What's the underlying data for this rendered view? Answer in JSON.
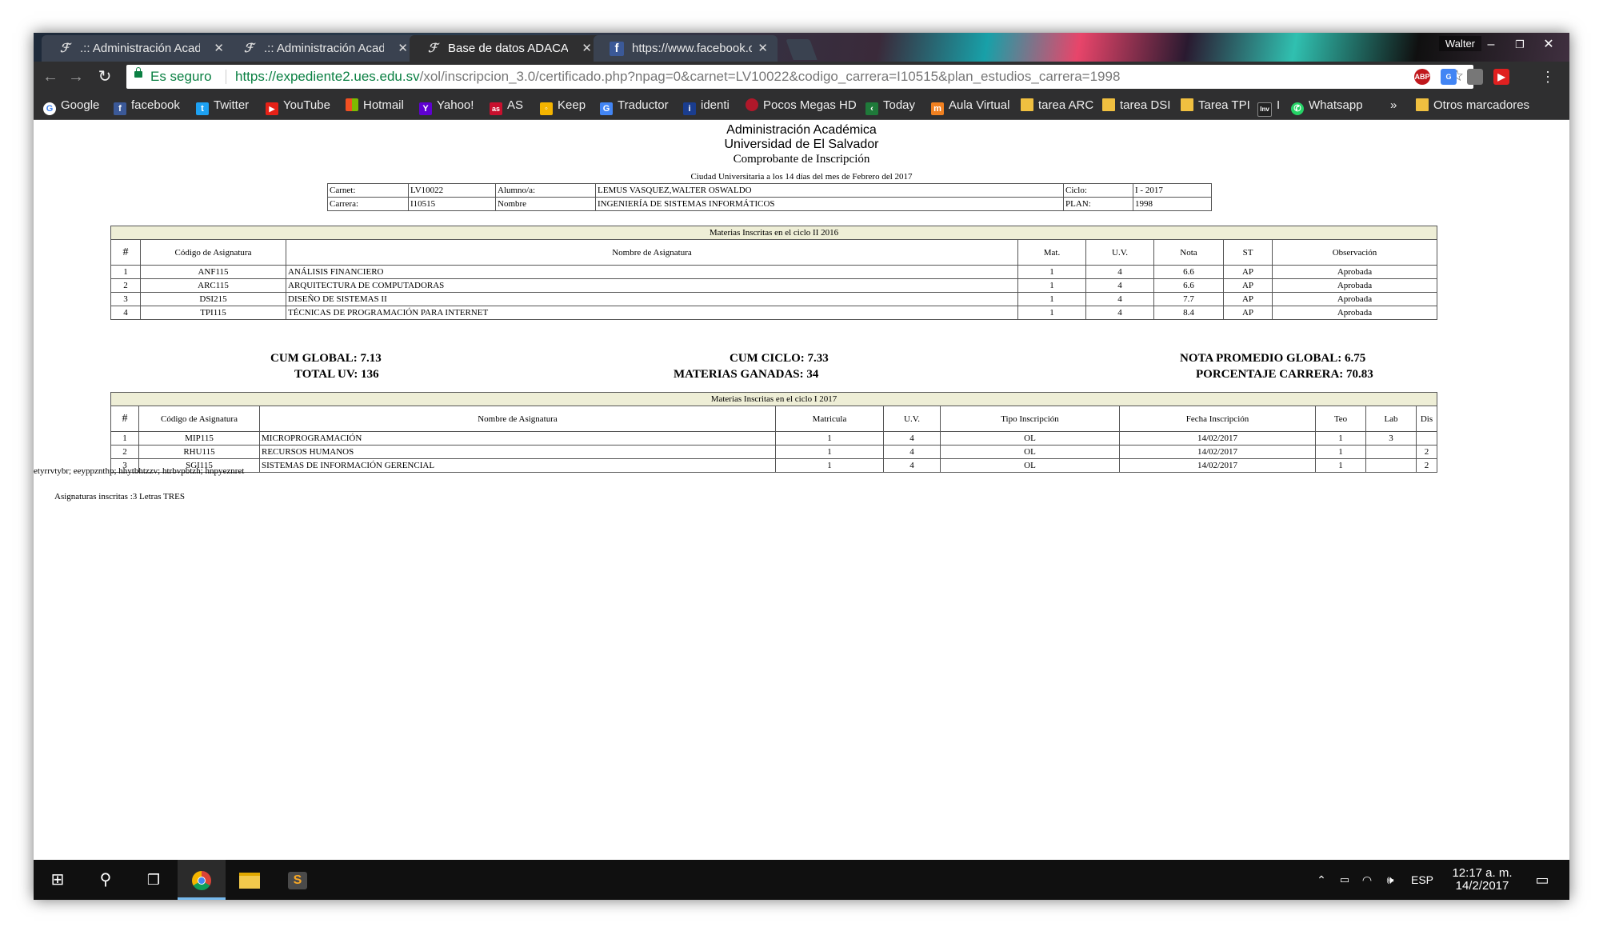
{
  "browser": {
    "tabs": [
      {
        "title": ".:: Administración Académ",
        "icon": "ues-logo-icon"
      },
      {
        "title": ".:: Administración Académ",
        "icon": "ues-logo-icon"
      },
      {
        "title": "Base de datos ADACAD",
        "icon": "ues-logo-icon"
      },
      {
        "title": "https://www.facebook.co",
        "icon": "facebook-icon"
      }
    ],
    "user": "Walter",
    "secure_label": "Es seguro",
    "url_host": "https://expediente2.ues.edu.sv",
    "url_path": "/xol/inscripcion_3.0/certificado.php?npag=0&carnet=LV10022&codigo_carrera=I10515&plan_estudios_carrera=1998",
    "extensions": [
      "ABP",
      "G",
      "",
      ""
    ],
    "bookmarks": [
      "Google",
      "facebook",
      "Twitter",
      "YouTube",
      "Hotmail",
      "Yahoo!",
      "AS",
      "Keep",
      "Traductor",
      "identi",
      "Pocos Megas HD",
      "Today",
      "Aula Virtual",
      "tarea ARC",
      "tarea DSI",
      "Tarea TPI",
      "I",
      "Whatsapp",
      "»",
      "Otros marcadores"
    ]
  },
  "page": {
    "header": {
      "line1": "Administración Académica",
      "line2": "Universidad de El Salvador",
      "line3": "Comprobante de Inscripción",
      "date_line": "Ciudad Universitaria a los 14 días del mes de Febrero del 2017"
    },
    "student": {
      "carnet_label": "Carnet:",
      "carnet": "LV10022",
      "alumno_label": "Alumno/a:",
      "alumno": "LEMUS VASQUEZ,WALTER OSWALDO",
      "ciclo_label": "Ciclo:",
      "ciclo": "I - 2017",
      "carrera_label": "Carrera:",
      "carrera": "I10515",
      "nombre_label": "Nombre",
      "nombre": "INGENIERÍA DE SISTEMAS INFORMÁTICOS",
      "plan_label": "PLAN:",
      "plan": "1998"
    },
    "prev_cycle": {
      "caption": "Materias Inscritas en el ciclo II 2016",
      "headers": [
        "#",
        "Código de Asignatura",
        "Nombre de Asignatura",
        "Mat.",
        "U.V.",
        "Nota",
        "ST",
        "Observación"
      ],
      "rows": [
        [
          "1",
          "ANF115",
          "ANÁLISIS FINANCIERO",
          "1",
          "4",
          "6.6",
          "AP",
          "Aprobada"
        ],
        [
          "2",
          "ARC115",
          "ARQUITECTURA DE COMPUTADORAS",
          "1",
          "4",
          "6.6",
          "AP",
          "Aprobada"
        ],
        [
          "3",
          "DSI215",
          "DISEÑO DE SISTEMAS II",
          "1",
          "4",
          "7.7",
          "AP",
          "Aprobada"
        ],
        [
          "4",
          "TPI115",
          "TÉCNICAS DE PROGRAMACIÓN PARA INTERNET",
          "1",
          "4",
          "8.4",
          "AP",
          "Aprobada"
        ]
      ]
    },
    "stats": {
      "cum_global": "CUM GLOBAL: 7.13",
      "total_uv": "TOTAL UV: 136",
      "cum_ciclo": "CUM CICLO: 7.33",
      "materias_ganadas": "MATERIAS GANADAS: 34",
      "nota_promedio": "NOTA PROMEDIO GLOBAL: 6.75",
      "porcentaje": "PORCENTAJE CARRERA: 70.83"
    },
    "current_cycle": {
      "caption": "Materias Inscritas en el ciclo I 2017",
      "headers": [
        "#",
        "Código de Asignatura",
        "Nombre de Asignatura",
        "Matricula",
        "U.V.",
        "Tipo Inscripción",
        "Fecha Inscripción",
        "Teo",
        "Lab",
        "Dis"
      ],
      "rows": [
        [
          "1",
          "MIP115",
          "MICROPROGRAMACIÓN",
          "1",
          "4",
          "OL",
          "14/02/2017",
          "1",
          "3",
          ""
        ],
        [
          "2",
          "RHU115",
          "RECURSOS HUMANOS",
          "1",
          "4",
          "OL",
          "14/02/2017",
          "1",
          "",
          "2"
        ],
        [
          "3",
          "SGI115",
          "SISTEMAS DE INFORMACIÓN GERENCIAL",
          "1",
          "4",
          "OL",
          "14/02/2017",
          "1",
          "",
          "2"
        ]
      ]
    },
    "code_line": "etyrrvtybr; eeyppznthp; hhytbhtzzv; htrbvpbtzh; hnpyeznret",
    "summary": "Asignaturas inscritas :3 Letras TRES"
  },
  "taskbar": {
    "apps": [
      "start-icon",
      "search-icon",
      "task-view-icon",
      "chrome-icon",
      "file-explorer-icon",
      "sublime-text-icon"
    ],
    "language": "ESP",
    "time": "12:17 a. m.",
    "date": "14/2/2017"
  }
}
